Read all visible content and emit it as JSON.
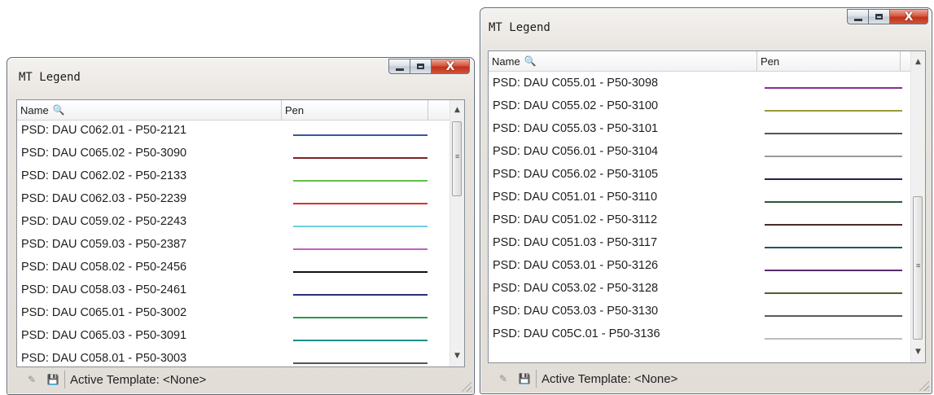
{
  "windows": [
    {
      "title": "MT Legend",
      "columns": {
        "name": "Name",
        "pen": "Pen"
      },
      "rows": [
        {
          "name": "PSD: DAU C062.01 - P50-2121",
          "pen_color": "#3a55a4"
        },
        {
          "name": "PSD: DAU C065.02 - P50-3090",
          "pen_color": "#7b2323"
        },
        {
          "name": "PSD: DAU C062.02 - P50-2133",
          "pen_color": "#63c24a"
        },
        {
          "name": "PSD: DAU C062.03 - P50-2239",
          "pen_color": "#dd3030"
        },
        {
          "name": "PSD: DAU C059.02 - P50-2243",
          "pen_color": "#6fd0e0"
        },
        {
          "name": "PSD: DAU C059.03 - P50-2387",
          "pen_color": "#c060c0"
        },
        {
          "name": "PSD: DAU C058.02 - P50-2456",
          "pen_color": "#111111"
        },
        {
          "name": "PSD: DAU C058.03 - P50-2461",
          "pen_color": "#2b2f7a"
        },
        {
          "name": "PSD: DAU C065.01 - P50-3002",
          "pen_color": "#2c9a4c"
        },
        {
          "name": "PSD: DAU C065.03 - P50-3091",
          "pen_color": "#1d8b8b"
        },
        {
          "name": "PSD: DAU C058.01 - P50-3003",
          "pen_color": "#555555"
        }
      ],
      "status": {
        "text": "Active Template: <None>"
      }
    },
    {
      "title": "MT Legend",
      "columns": {
        "name": "Name",
        "pen": "Pen"
      },
      "rows": [
        {
          "name": "PSD: DAU C055.01 - P50-3098",
          "pen_color": "#8a2a9a"
        },
        {
          "name": "PSD: DAU C055.02 - P50-3100",
          "pen_color": "#9a9a3a"
        },
        {
          "name": "PSD: DAU C055.03 - P50-3101",
          "pen_color": "#555555"
        },
        {
          "name": "PSD: DAU C056.01 - P50-3104",
          "pen_color": "#9a9a9a"
        },
        {
          "name": "PSD: DAU C056.02 - P50-3105",
          "pen_color": "#222255"
        },
        {
          "name": "PSD: DAU C051.01 - P50-3110",
          "pen_color": "#2a5a3a"
        },
        {
          "name": "PSD: DAU C051.02 - P50-3112",
          "pen_color": "#4a2a2a"
        },
        {
          "name": "PSD: DAU C051.03 - P50-3117",
          "pen_color": "#1e5a5a"
        },
        {
          "name": "PSD: DAU C053.01 - P50-3126",
          "pen_color": "#5a2a6a"
        },
        {
          "name": "PSD: DAU C053.02 - P50-3128",
          "pen_color": "#5a5a2a"
        },
        {
          "name": "PSD: DAU C053.03 - P50-3130",
          "pen_color": "#5a5a5a"
        },
        {
          "name": "PSD: DAU C05C.01 - P50-3136",
          "pen_color": "#bdbdbd"
        }
      ],
      "status": {
        "text": "Active Template: <None>"
      }
    }
  ]
}
